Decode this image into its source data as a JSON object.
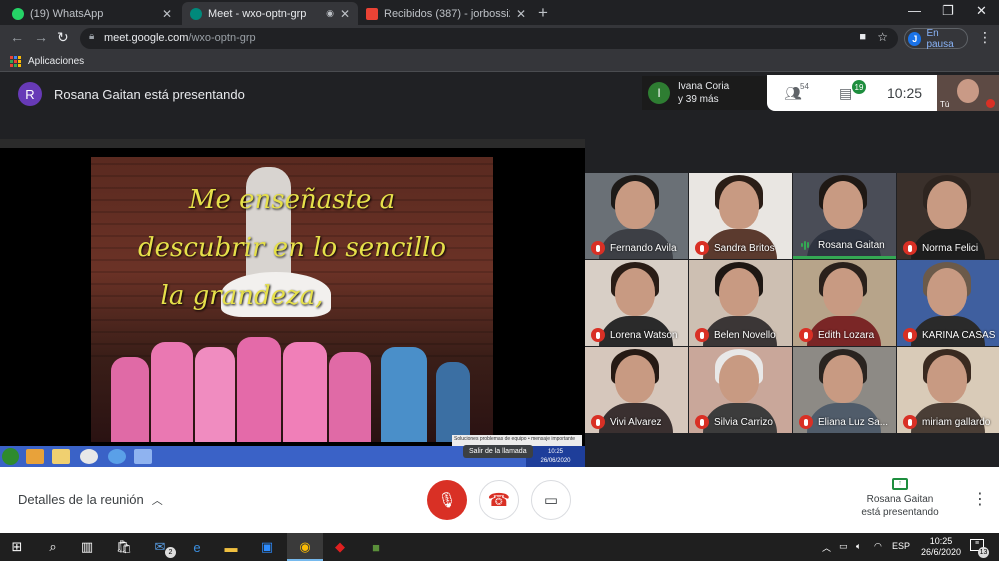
{
  "tabs": [
    {
      "label": "(19) WhatsApp",
      "icon": "whatsapp-icon",
      "color": "#25d366"
    },
    {
      "label": "Meet - wxo-optn-grp",
      "icon": "meet-icon",
      "color": "#00897b",
      "active": true
    },
    {
      "label": "Recibidos (387) - jorbossi2014@",
      "icon": "gmail-icon",
      "color": "#ea4335"
    }
  ],
  "omnibox": {
    "host": "meet.google.com",
    "path": "/wxo-optn-grp"
  },
  "profile": {
    "initial": "J",
    "status": "En pausa"
  },
  "bookmarks": {
    "apps_label": "Aplicaciones"
  },
  "meet": {
    "presenter_initial": "R",
    "presenter_text": "Rosana Gaitan está presentando",
    "people_chip": {
      "initial": "I",
      "line1": "Ivana Coria",
      "line2": "y 39 más"
    },
    "participants_count": "54",
    "chat_count": "19",
    "clock": "10:25",
    "self_label": "Tú"
  },
  "slide": {
    "lines": [
      "Me enseñaste a",
      "descubrir en lo sencillo",
      "la grandeza,"
    ]
  },
  "remote_screen": {
    "notification": "Soluciones problemas de equipo • mensaje importante",
    "tray_time": "10:25",
    "tray_date": "26/06/2020",
    "tooltip": "Salir de la llamada"
  },
  "participants": [
    {
      "name": "Fernando Avila",
      "bg": "#6a7076",
      "hair": "#1d1a18",
      "shirt": "#3d3f45",
      "state": "muted"
    },
    {
      "name": "Sandra Britos",
      "bg": "#e9e6e2",
      "hair": "#2b1e17",
      "shirt": "#5b3a2e",
      "state": "muted"
    },
    {
      "name": "Rosana Gaitan",
      "bg": "#4a4d57",
      "hair": "#1f1915",
      "shirt": "#2f3440",
      "state": "speaking"
    },
    {
      "name": "Norma Felici",
      "bg": "#3a302b",
      "hair": "#2e2520",
      "shirt": "#1e1e1e",
      "state": "muted"
    },
    {
      "name": "Lorena Watson",
      "bg": "#d8cfc6",
      "hair": "#2a1d16",
      "shirt": "#2a2a2a",
      "state": "muted"
    },
    {
      "name": "Belen Novello",
      "bg": "#cdbfb2",
      "hair": "#1e1713",
      "shirt": "#3b3636",
      "state": "muted"
    },
    {
      "name": "Edith Lozara",
      "bg": "#b7a48a",
      "hair": "#2a201b",
      "shirt": "#7a2626",
      "state": "muted"
    },
    {
      "name": "KARINA CASAS",
      "bg": "#3f5f9f",
      "hair": "#6b5a4a",
      "shirt": "#2a2a2a",
      "state": "muted"
    },
    {
      "name": "Vivi Alvarez",
      "bg": "#d6c7bc",
      "hair": "#261a14",
      "shirt": "#3a3030",
      "state": "muted"
    },
    {
      "name": "Silvia Carrizo",
      "bg": "#c9a79a",
      "hair": "#e8e8e8",
      "shirt": "#3c3c3c",
      "state": "muted"
    },
    {
      "name": "Eliana Luz Sa...",
      "bg": "#8d8a85",
      "hair": "#2a2420",
      "shirt": "#505c6a",
      "state": "muted"
    },
    {
      "name": "miriam gallardo",
      "bg": "#d9cbb8",
      "hair": "#3a2a20",
      "shirt": "#4a3e36",
      "state": "muted"
    }
  ],
  "bottom": {
    "details_label": "Detalles de la reunión",
    "presenting_line1": "Rosana Gaitan",
    "presenting_line2": "está presentando"
  },
  "taskbar": {
    "lang": "ESP",
    "time": "10:25",
    "date": "26/6/2020",
    "mail_badge": "2",
    "notify_count": "13"
  }
}
